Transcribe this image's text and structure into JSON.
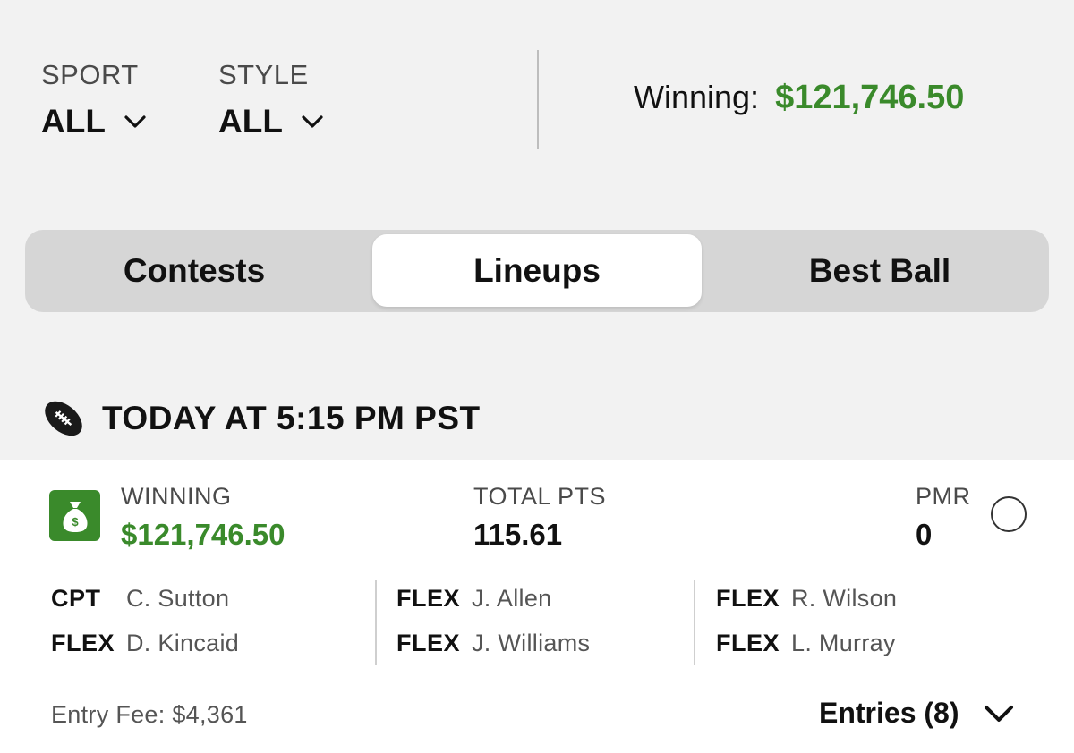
{
  "filters": {
    "sport": {
      "label": "SPORT",
      "value": "ALL"
    },
    "style": {
      "label": "STYLE",
      "value": "ALL"
    }
  },
  "summary": {
    "winning_label": "Winning:",
    "winning_amount": "$121,746.50"
  },
  "tabs": [
    {
      "label": "Contests",
      "selected": false
    },
    {
      "label": "Lineups",
      "selected": true
    },
    {
      "label": "Best Ball",
      "selected": false
    }
  ],
  "game": {
    "icon": "football-icon",
    "title": "TODAY AT 5:15 PM PST"
  },
  "card": {
    "icon": "money-bag-icon",
    "winning": {
      "label": "WINNING",
      "value": "$121,746.50"
    },
    "total_pts": {
      "label": "TOTAL PTS",
      "value": "115.61"
    },
    "pmr": {
      "label": "PMR",
      "value": "0"
    },
    "lineup": [
      [
        {
          "pos": "CPT",
          "player": "C. Sutton"
        },
        {
          "pos": "FLEX",
          "player": "D. Kincaid"
        }
      ],
      [
        {
          "pos": "FLEX",
          "player": "J. Allen"
        },
        {
          "pos": "FLEX",
          "player": "J. Williams"
        }
      ],
      [
        {
          "pos": "FLEX",
          "player": "R. Wilson"
        },
        {
          "pos": "FLEX",
          "player": "L. Murray"
        }
      ]
    ],
    "entry_fee": "Entry Fee: $4,361",
    "entries_label": "Entries (8)"
  },
  "colors": {
    "accent_green": "#3a8a2b",
    "background": "#f2f2f2",
    "card": "#ffffff"
  }
}
